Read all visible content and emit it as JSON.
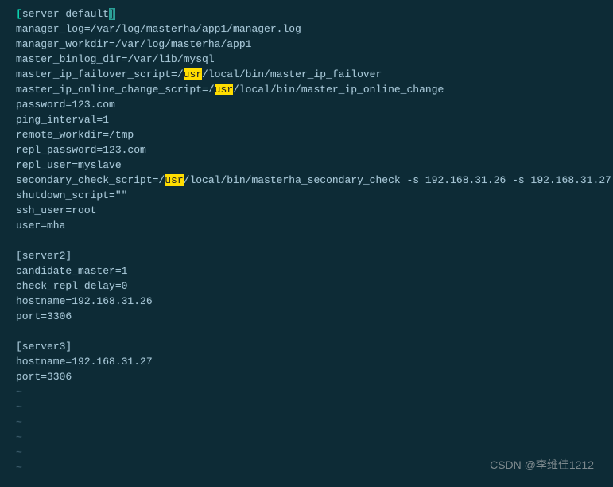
{
  "header": {
    "bracket_open": "[",
    "section_name": "server default",
    "bracket_close": "]"
  },
  "config": {
    "manager_log": "manager_log=/var/log/masterha/app1/manager.log",
    "manager_workdir": "manager_workdir=/var/log/masterha/app1",
    "master_binlog_dir": "master_binlog_dir=/var/lib/mysql",
    "failover_pre": "master_ip_failover_script=/",
    "failover_hl": "usr",
    "failover_post": "/local/bin/master_ip_failover",
    "online_pre": "master_ip_online_change_script=/",
    "online_hl": "usr",
    "online_post": "/local/bin/master_ip_online_change",
    "password": "password=123.com",
    "ping_interval": "ping_interval=1",
    "remote_workdir": "remote_workdir=/tmp",
    "repl_password": "repl_password=123.com",
    "repl_user": "repl_user=myslave",
    "secondary_pre": "secondary_check_script=/",
    "secondary_hl": "usr",
    "secondary_post": "/local/bin/masterha_secondary_check -s 192.168.31.26 -s 192.168.31.27",
    "shutdown_script": "shutdown_script=\"\"",
    "ssh_user": "ssh_user=root",
    "user": "user=mha"
  },
  "server2": {
    "header": "[server2]",
    "candidate_master": "candidate_master=1",
    "check_repl_delay": "check_repl_delay=0",
    "hostname": "hostname=192.168.31.26",
    "port": "port=3306"
  },
  "server3": {
    "header": "[server3]",
    "hostname": "hostname=192.168.31.27",
    "port": "port=3306"
  },
  "tilde": "~",
  "watermark": "CSDN @李维佳1212"
}
